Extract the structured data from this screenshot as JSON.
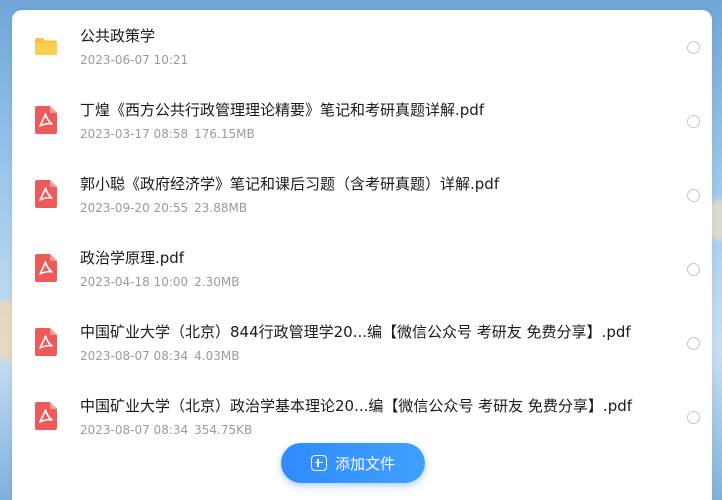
{
  "files": [
    {
      "name": "公共政策学",
      "date": "2023-06-07 10:21",
      "size": "",
      "type": "folder"
    },
    {
      "name": "丁煌《西方公共行政管理理论精要》笔记和考研真题详解.pdf",
      "date": "2023-03-17 08:58",
      "size": "176.15MB",
      "type": "pdf"
    },
    {
      "name": "郭小聪《政府经济学》笔记和课后习题（含考研真题）详解.pdf",
      "date": "2023-09-20 20:55",
      "size": "23.88MB",
      "type": "pdf"
    },
    {
      "name": "政治学原理.pdf",
      "date": "2023-04-18 10:00",
      "size": "2.30MB",
      "type": "pdf"
    },
    {
      "name": "中国矿业大学（北京）844行政管理学20...编【微信公众号 考研友 免费分享】.pdf",
      "date": "2023-08-07 08:34",
      "size": "4.03MB",
      "type": "pdf"
    },
    {
      "name": "中国矿业大学（北京）政治学基本理论20...编【微信公众号 考研友 免费分享】.pdf",
      "date": "2023-08-07 08:34",
      "size": "354.75KB",
      "type": "pdf"
    }
  ],
  "add_button": {
    "label": "添加文件"
  },
  "colors": {
    "folder": "#f6c343",
    "pdf": "#ee5a5a",
    "accent": "#2f8bff"
  }
}
